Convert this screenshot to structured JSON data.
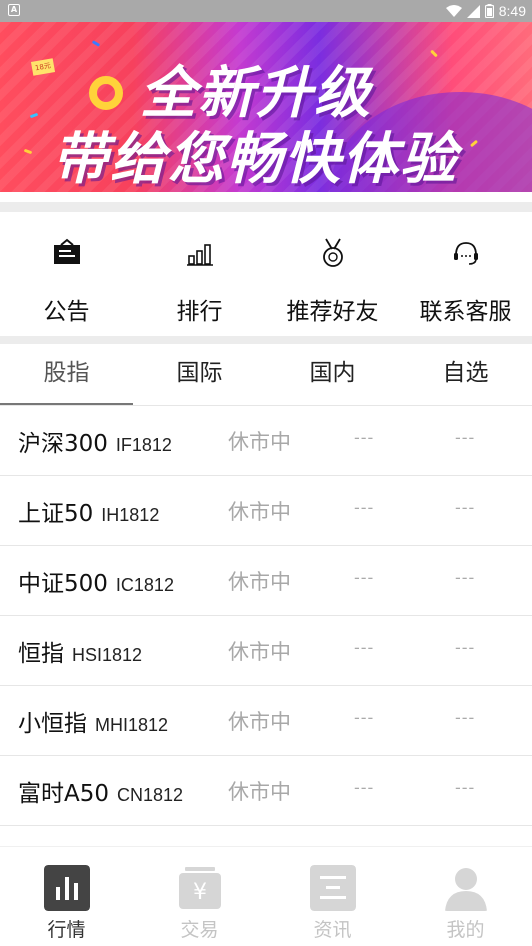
{
  "status_bar": {
    "time": "8:49",
    "notification_icon": "android-notification-icon"
  },
  "banner": {
    "line1": "全新升级",
    "line2": "带给您畅快体验",
    "tag": "18元"
  },
  "quick_menu": [
    {
      "label": "公告",
      "icon": "announcement-icon"
    },
    {
      "label": "排行",
      "icon": "bar-chart-icon"
    },
    {
      "label": "推荐好友",
      "icon": "medal-icon"
    },
    {
      "label": "联系客服",
      "icon": "headset-icon"
    }
  ],
  "market_tabs": [
    {
      "label": "股指",
      "active": true
    },
    {
      "label": "国际",
      "active": false
    },
    {
      "label": "国内",
      "active": false
    },
    {
      "label": "自选",
      "active": false
    }
  ],
  "quotes": [
    {
      "name": "沪深300",
      "code": "IF1812",
      "status": "休市中",
      "v1": "---",
      "v2": "---"
    },
    {
      "name": "上证50",
      "code": "IH1812",
      "status": "休市中",
      "v1": "---",
      "v2": "---"
    },
    {
      "name": "中证500",
      "code": "IC1812",
      "status": "休市中",
      "v1": "---",
      "v2": "---"
    },
    {
      "name": "恒指",
      "code": "HSI1812",
      "status": "休市中",
      "v1": "---",
      "v2": "---"
    },
    {
      "name": "小恒指",
      "code": "MHI1812",
      "status": "休市中",
      "v1": "---",
      "v2": "---"
    },
    {
      "name": "富时A50",
      "code": "CN1812",
      "status": "休市中",
      "v1": "---",
      "v2": "---"
    },
    {
      "name": "",
      "code": "",
      "status": "",
      "v1": "",
      "v2": ""
    }
  ],
  "bottom_nav": [
    {
      "label": "行情",
      "icon": "market-chart-icon",
      "active": true
    },
    {
      "label": "交易",
      "icon": "yuan-wallet-icon",
      "active": false
    },
    {
      "label": "资讯",
      "icon": "news-icon",
      "active": false
    },
    {
      "label": "我的",
      "icon": "user-icon",
      "active": false
    }
  ],
  "colors": {
    "status_bar": "#a9a9a9",
    "active_nav_icon": "#444444",
    "inactive_nav_icon": "#d6d6d6",
    "muted_text": "#a8a8a8",
    "divider": "#ececec"
  }
}
